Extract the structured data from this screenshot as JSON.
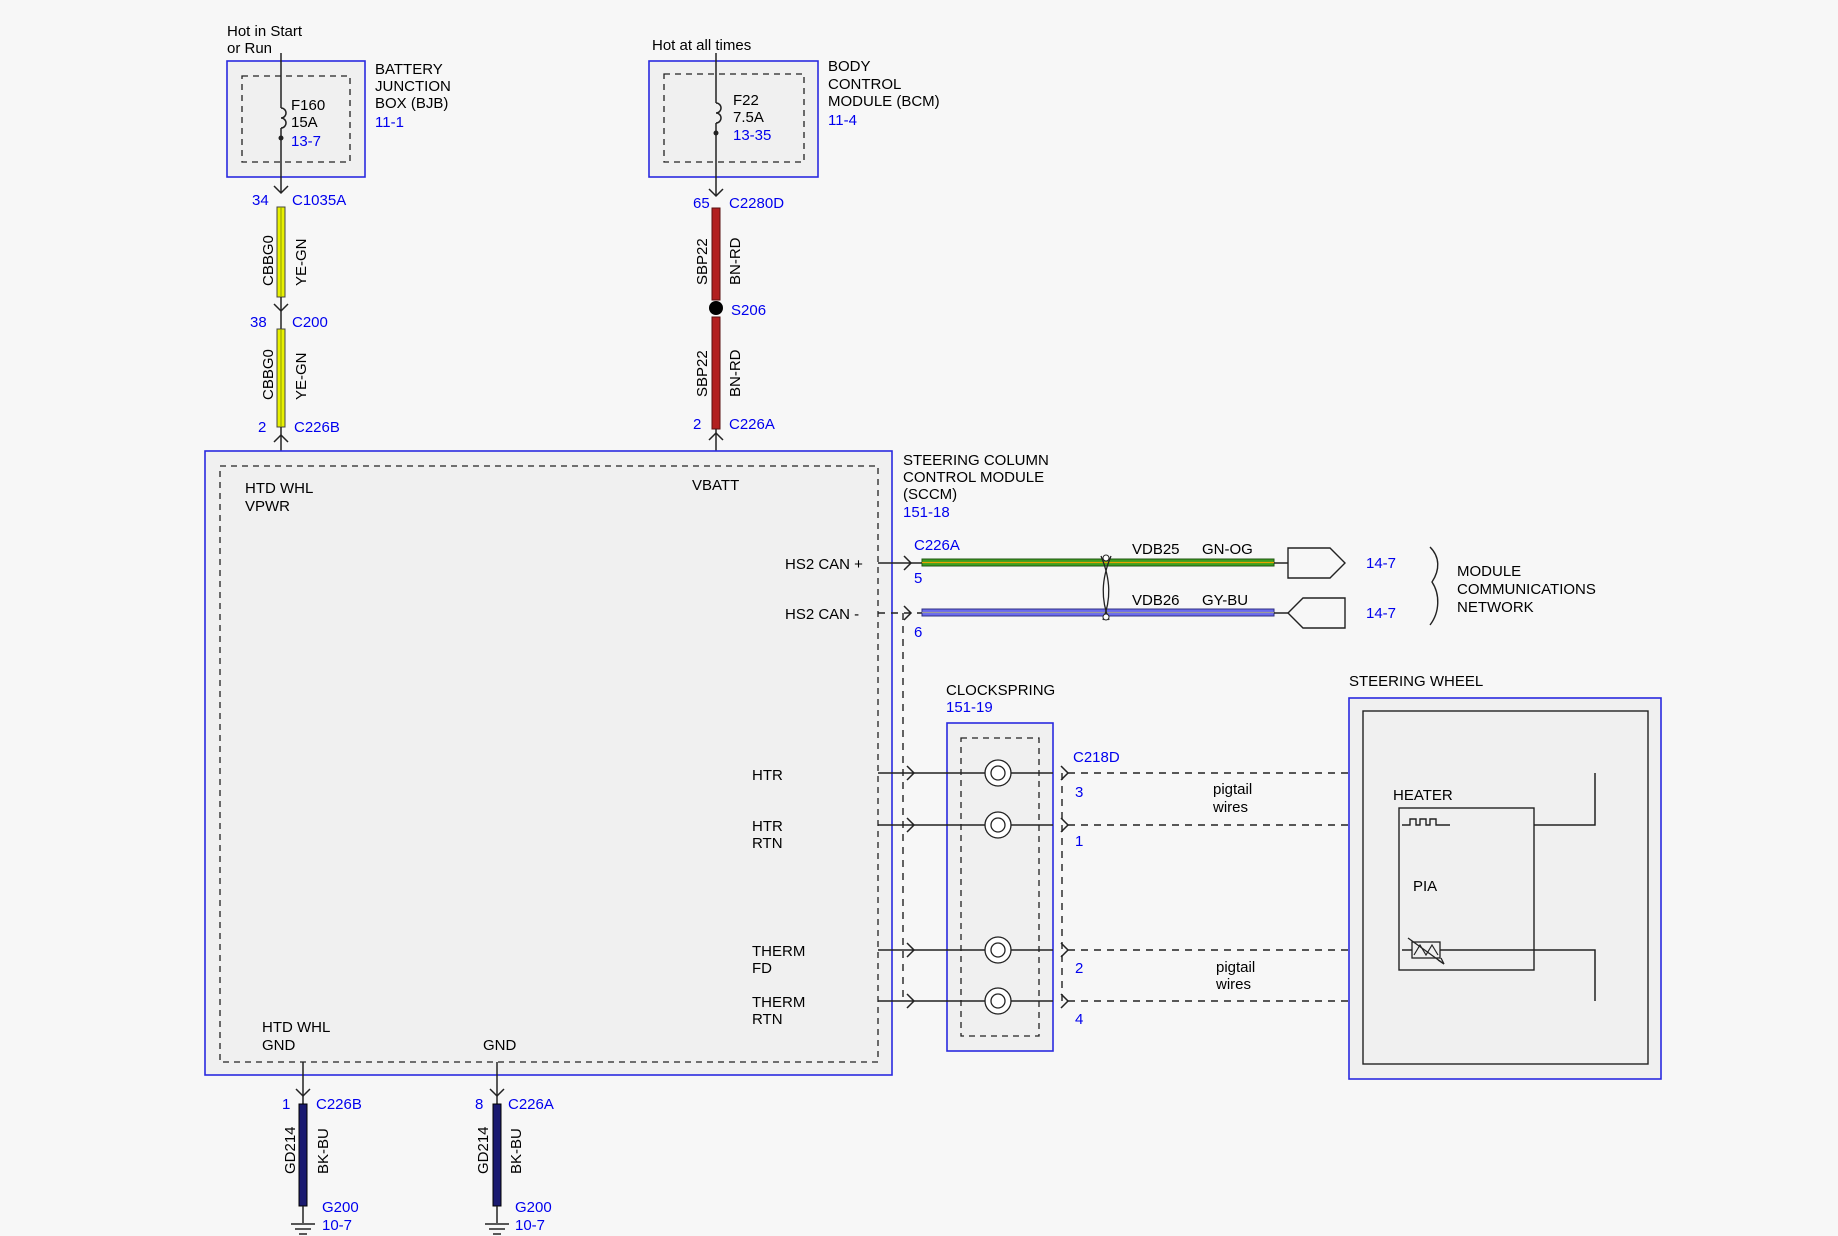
{
  "top_left": {
    "source": [
      "Hot in Start",
      "or Run"
    ],
    "module": [
      "BATTERY",
      "JUNCTION",
      "BOX (BJB)"
    ],
    "module_ref": "11-1",
    "fuse": {
      "name": "F160",
      "rating": "15A",
      "ref": "13-7"
    },
    "conn1": {
      "pin": "34",
      "name": "C1035A"
    },
    "wire1": {
      "circuit": "CBBG0",
      "color": "YE-GN"
    },
    "conn2": {
      "pin": "38",
      "name": "C200"
    },
    "wire2": {
      "circuit": "CBBG0",
      "color": "YE-GN"
    },
    "conn3": {
      "pin": "2",
      "name": "C226B"
    }
  },
  "top_mid": {
    "source": "Hot at all times",
    "module": [
      "BODY",
      "CONTROL",
      "MODULE (BCM)"
    ],
    "module_ref": "11-4",
    "fuse": {
      "name": "F22",
      "rating": "7.5A",
      "ref": "13-35"
    },
    "conn1": {
      "pin": "65",
      "name": "C2280D"
    },
    "wire1": {
      "circuit": "SBP22",
      "color": "BN-RD"
    },
    "splice": "S206",
    "wire2": {
      "circuit": "SBP22",
      "color": "BN-RD"
    },
    "conn2": {
      "pin": "2",
      "name": "C226A"
    }
  },
  "sccm": {
    "title": [
      "STEERING COLUMN",
      "CONTROL MODULE",
      "(SCCM)"
    ],
    "ref": "151-18",
    "pins": {
      "htd_whl_vpwr": [
        "HTD WHL",
        "VPWR"
      ],
      "vbatt": "VBATT",
      "hs2_can_plus": "HS2 CAN +",
      "hs2_can_minus": "HS2 CAN -",
      "htr": "HTR",
      "htr_rtn": [
        "HTR",
        "RTN"
      ],
      "therm_fd": [
        "THERM",
        "FD"
      ],
      "therm_rtn": [
        "THERM",
        "RTN"
      ],
      "htd_whl_gnd": [
        "HTD WHL",
        "GND"
      ],
      "gnd": "GND"
    }
  },
  "can": {
    "connector": "C226A",
    "plus": {
      "pin": "5",
      "circuit": "VDB25",
      "color": "GN-OG",
      "ref": "14-7"
    },
    "minus": {
      "pin": "6",
      "circuit": "VDB26",
      "color": "GY-BU",
      "ref": "14-7"
    },
    "network": [
      "MODULE",
      "COMMUNICATIONS",
      "NETWORK"
    ]
  },
  "clockspring": {
    "title": "CLOCKSPRING",
    "ref": "151-19",
    "connector": "C218D",
    "pins": [
      "3",
      "1",
      "2",
      "4"
    ],
    "pigtail": [
      "pigtail",
      "wires"
    ]
  },
  "steering_wheel": {
    "title": "STEERING WHEEL",
    "heater": "HEATER",
    "pia": "PIA"
  },
  "grounds": {
    "left": {
      "pin": "1",
      "connector": "C226B",
      "circuit": "GD214",
      "color": "BK-BU",
      "ground": "G200",
      "ref": "10-7"
    },
    "right": {
      "pin": "8",
      "connector": "C226A",
      "circuit": "GD214",
      "color": "BK-BU",
      "ground": "G200",
      "ref": "10-7"
    }
  },
  "colors": {
    "blue_frame": "#2a2ae0",
    "ref_text": "#0000ee",
    "ye_gn": "#e8f000",
    "bn_rd": "#b22020",
    "gn_og": "#3aa020",
    "gy_bu": "#6a6af0",
    "bk_bu": "#1a1a70"
  }
}
